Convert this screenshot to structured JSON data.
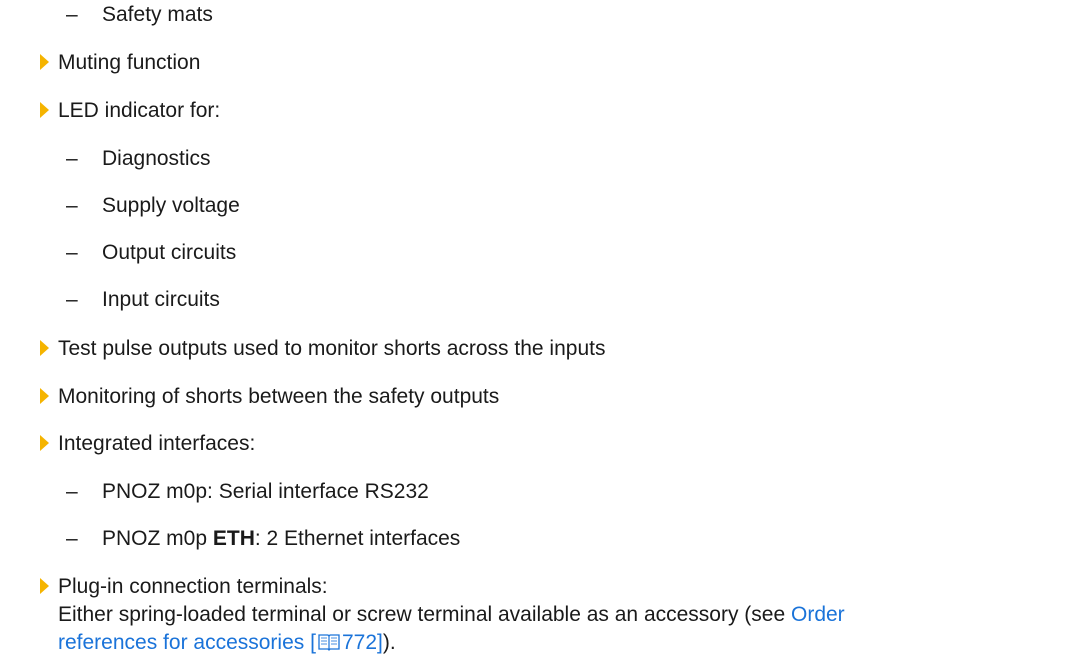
{
  "items": [
    {
      "level": 2,
      "text": "Safety mats"
    },
    {
      "level": 1,
      "text": "Muting function"
    },
    {
      "level": 1,
      "text": "LED indicator for:"
    },
    {
      "level": 2,
      "text": "Diagnostics"
    },
    {
      "level": 2,
      "text": "Supply voltage"
    },
    {
      "level": 2,
      "text": "Output circuits"
    },
    {
      "level": 2,
      "text": "Input circuits"
    },
    {
      "level": 1,
      "text": "Test pulse outputs used to monitor shorts across the inputs"
    },
    {
      "level": 1,
      "text": "Monitoring of shorts between the safety outputs"
    },
    {
      "level": 1,
      "text": "Integrated interfaces:"
    },
    {
      "level": 2,
      "text": "PNOZ m0p: Serial interface RS232"
    }
  ],
  "dash_glyph": "–",
  "eth_item": {
    "prefix": "PNOZ m0p ",
    "bold": "ETH",
    "suffix": ": 2 Ethernet interfaces"
  },
  "plugin_item": {
    "line1": "Plug-in connection terminals:",
    "line2_text": "Either spring-loaded terminal or screw terminal available as an accessory (see ",
    "link_part1": "Order",
    "link_part2": "references for accessories",
    "bracket_open": "[",
    "page_ref": "772",
    "bracket_close": "]",
    "tail": ")."
  },
  "colors": {
    "bullet": "#f5b400",
    "link": "#1a73d9",
    "text": "#1a1a1a"
  },
  "icons": {
    "bullet": "triangle-bullet-icon",
    "book": "book-icon"
  }
}
